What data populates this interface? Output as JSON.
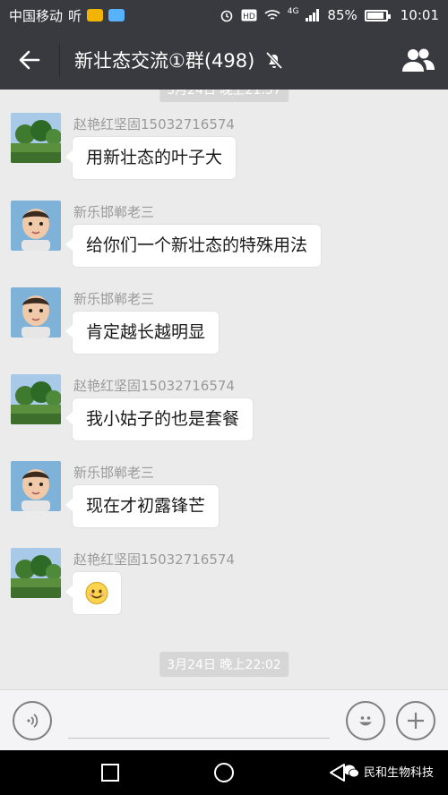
{
  "status_bar": {
    "carrier": "中国移动",
    "carrier_extra": "听",
    "network": "4G",
    "battery": "85%",
    "battery_level": 0.85,
    "time": "10:01"
  },
  "header": {
    "title": "新壮态交流①群(498)"
  },
  "messages": [
    {
      "sender": "赵艳红坚固15032716574",
      "text": "用新壮态的叶子大",
      "avatar": "landscape"
    },
    {
      "sender": "新乐邯郸老三",
      "text": "给你们一个新壮态的特殊用法",
      "avatar": "baby"
    },
    {
      "sender": "新乐邯郸老三",
      "text": "肯定越长越明显",
      "avatar": "baby"
    },
    {
      "sender": "赵艳红坚固15032716574",
      "text": "我小姑子的也是套餐",
      "avatar": "landscape"
    },
    {
      "sender": "新乐邯郸老三",
      "text": "现在才初露锋芒",
      "avatar": "baby"
    },
    {
      "sender": "赵艳红坚固15032716574",
      "text": "",
      "emoji": "smile-emoji",
      "avatar": "landscape"
    }
  ],
  "timestamps": {
    "bottom": "3月24日 晚上22:02"
  },
  "input": {
    "placeholder": ""
  },
  "watermark": {
    "text": "民和生物科技"
  },
  "colors": {
    "header_bg": "#393a3f",
    "chat_bg": "#ebebeb",
    "bubble": "#ffffff",
    "sender": "#9a9a9a"
  }
}
